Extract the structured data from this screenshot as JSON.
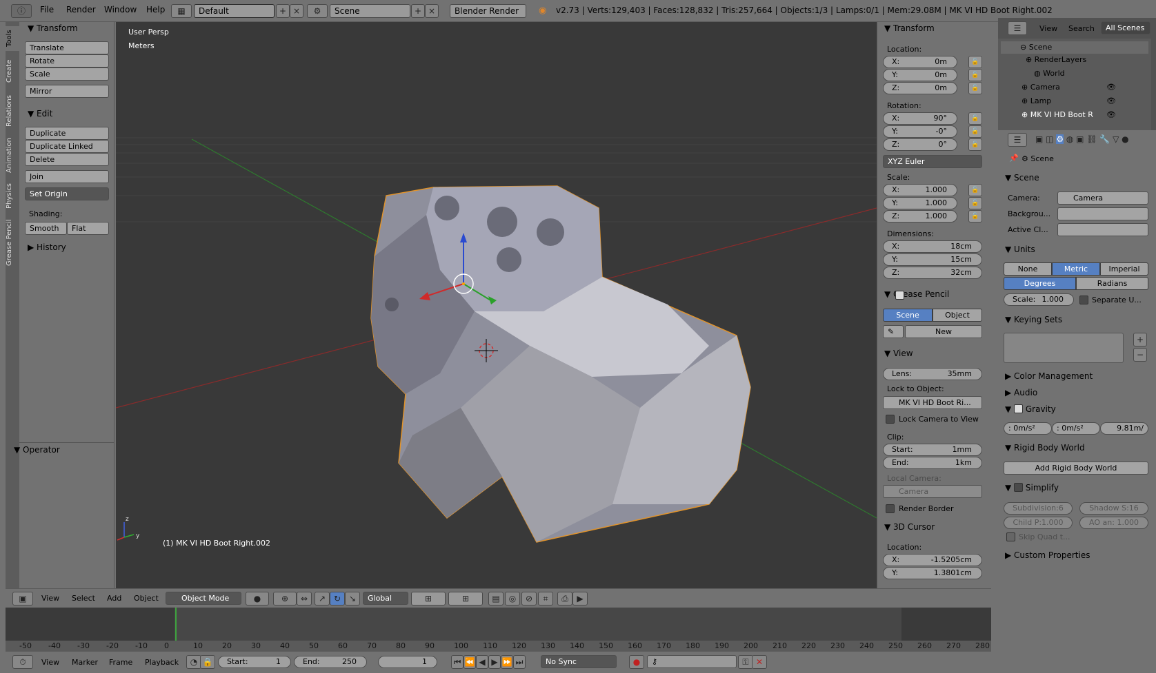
{
  "menu": {
    "file": "File",
    "render": "Render",
    "window": "Window",
    "help": "Help"
  },
  "layout": "Default",
  "scene": "Scene",
  "engine": "Blender Render",
  "stats": "v2.73 | Verts:129,403 | Faces:128,832 | Tris:257,664 | Objects:1/3 | Lamps:0/1 | Mem:29.08M | MK VI HD Boot Right.002",
  "tabs": [
    "Tools",
    "Create",
    "Relations",
    "Animation",
    "Physics",
    "Grease Pencil"
  ],
  "tools": {
    "transform": "Transform",
    "translate": "Translate",
    "rotate": "Rotate",
    "scale": "Scale",
    "mirror": "Mirror",
    "edit": "Edit",
    "duplicate": "Duplicate",
    "duplicate_linked": "Duplicate Linked",
    "delete": "Delete",
    "join": "Join",
    "set_origin": "Set Origin",
    "shading": "Shading:",
    "smooth": "Smooth",
    "flat": "Flat",
    "history": "History",
    "operator": "Operator"
  },
  "viewport": {
    "persp": "User Persp",
    "units": "Meters",
    "object_label": "(1) MK VI HD Boot Right.002"
  },
  "npanel": {
    "transform": "Transform",
    "location": "Location:",
    "loc": [
      {
        "k": "X:",
        "v": "0m"
      },
      {
        "k": "Y:",
        "v": "0m"
      },
      {
        "k": "Z:",
        "v": "0m"
      }
    ],
    "rotation": "Rotation:",
    "rot": [
      {
        "k": "X:",
        "v": "90°"
      },
      {
        "k": "Y:",
        "v": "-0°"
      },
      {
        "k": "Z:",
        "v": "0°"
      }
    ],
    "rot_mode": "XYZ Euler",
    "scale": "Scale:",
    "scl": [
      {
        "k": "X:",
        "v": "1.000"
      },
      {
        "k": "Y:",
        "v": "1.000"
      },
      {
        "k": "Z:",
        "v": "1.000"
      }
    ],
    "dimensions": "Dimensions:",
    "dim": [
      {
        "k": "X:",
        "v": "18cm"
      },
      {
        "k": "Y:",
        "v": "15cm"
      },
      {
        "k": "Z:",
        "v": "32cm"
      }
    ],
    "grease_pencil": "Grease Pencil",
    "gp_scene": "Scene",
    "gp_object": "Object",
    "gp_new": "New",
    "view": "View",
    "lens_k": "Lens:",
    "lens_v": "35mm",
    "lock_to_object": "Lock to Object:",
    "lock_obj": "MK VI HD Boot Ri...",
    "lock_camera": "Lock Camera to View",
    "clip": "Clip:",
    "clip_start_k": "Start:",
    "clip_start_v": "1mm",
    "clip_end_k": "End:",
    "clip_end_v": "1km",
    "local_camera": "Local Camera:",
    "local_cam_val": "Camera",
    "render_border": "Render Border",
    "cursor": "3D Cursor",
    "cursor_loc": "Location:",
    "cx_k": "X:",
    "cx_v": "-1.5205cm",
    "cy_k": "Y:",
    "cy_v": "1.3801cm"
  },
  "vheader": {
    "view": "View",
    "select": "Select",
    "add": "Add",
    "object": "Object",
    "mode": "Object Mode",
    "orient": "Global"
  },
  "timeline": {
    "ticks": [
      "-50",
      "-40",
      "-30",
      "-20",
      "-10",
      "0",
      "10",
      "20",
      "30",
      "40",
      "50",
      "60",
      "70",
      "80",
      "90",
      "100",
      "110",
      "120",
      "130",
      "140",
      "150",
      "160",
      "170",
      "180",
      "190",
      "200",
      "210",
      "220",
      "230",
      "240",
      "250",
      "260",
      "270",
      "280"
    ],
    "view": "View",
    "marker": "Marker",
    "frame": "Frame",
    "playback": "Playback",
    "start_k": "Start:",
    "start_v": "1",
    "end_k": "End:",
    "end_v": "250",
    "current": "1",
    "sync": "No Sync"
  },
  "outliner": {
    "view": "View",
    "search": "Search",
    "all_scenes": "All Scenes",
    "items": [
      "Scene",
      "RenderLayers",
      "World",
      "Camera",
      "Lamp",
      "MK VI HD Boot R"
    ]
  },
  "props": {
    "scene_path": "Scene",
    "scene": "Scene",
    "camera_k": "Camera:",
    "camera_v": "Camera",
    "background": "Backgrou...",
    "active_clip": "Active Cl...",
    "units": "Units",
    "none": "None",
    "metric": "Metric",
    "imperial": "Imperial",
    "degrees": "Degrees",
    "radians": "Radians",
    "scale_k": "Scale:",
    "scale_v": "1.000",
    "separate": "Separate U...",
    "keying_sets": "Keying Sets",
    "color_mgmt": "Color Management",
    "audio": "Audio",
    "gravity": "Gravity",
    "g1": ": 0m/s²",
    "g2": ": 0m/s²",
    "g3": "9.81m/",
    "rigid_body": "Rigid Body World",
    "add_rigid": "Add Rigid Body World",
    "simplify": "Simplify",
    "subdiv": "Subdivision:6",
    "shadow": "Shadow S:16",
    "childp": "Child P:1.000",
    "aoan": "AO an: 1.000",
    "skip_quad": "Skip Quad t...",
    "custom": "Custom Properties"
  }
}
